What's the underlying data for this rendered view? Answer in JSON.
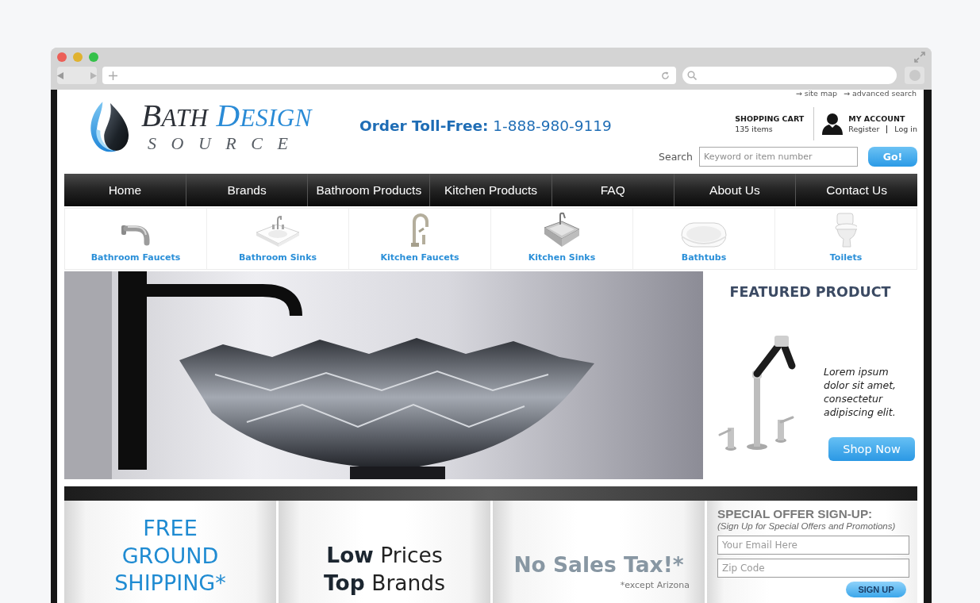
{
  "top_links": [
    "→ site map",
    "→ advanced search"
  ],
  "logo": {
    "name_dark": "BATH",
    "name_accent": "DESIGN",
    "tagline": "SOURCE"
  },
  "phone": "**Order Toll-Free:** 1-888-980-9119",
  "cart": {
    "title": "SHOPPING CART",
    "count": "135 items"
  },
  "account": {
    "title": "MY ACCOUNT",
    "links": [
      "Register",
      "Log in"
    ]
  },
  "search": {
    "label": "Search",
    "placeholder": "Keyword or item number",
    "button": "Go!"
  },
  "nav": [
    "Home",
    "Brands",
    "Bathroom Products",
    "Kitchen Products",
    "FAQ",
    "About Us",
    "Contact Us"
  ],
  "categories": [
    {
      "label": "Bathroom Faucets",
      "kind": "spout"
    },
    {
      "label": "Bathroom Sinks",
      "kind": "basin"
    },
    {
      "label": "Kitchen Faucets",
      "kind": "faucet"
    },
    {
      "label": "Kitchen Sinks",
      "kind": "steel-sink"
    },
    {
      "label": "Bathtubs",
      "kind": "tub"
    },
    {
      "label": "Toilets",
      "kind": "toilet"
    }
  ],
  "featured": {
    "title": "FEATURED PRODUCT",
    "description": "Lorem ipsum dolor sit amet, consectetur adipiscing elit.",
    "button": "Shop Now"
  },
  "promos": [
    {
      "kind": "shipping",
      "lines": [
        "FREE",
        "GROUND",
        "SHIPPING*"
      ]
    },
    {
      "kind": "prices",
      "lines": [
        "**Low** Prices",
        "**Top** Brands"
      ]
    },
    {
      "kind": "tax",
      "headline": "No Sales Tax!*",
      "note": "*except Arizona"
    },
    {
      "kind": "signup",
      "title": "SPECIAL OFFER SIGN-UP:",
      "subtitle": "(Sign Up for Special Offers and Promotions)",
      "fields": [
        {
          "placeholder": "Your Email Here"
        },
        {
          "placeholder": "Zip Code"
        }
      ],
      "button": "SIGN UP"
    }
  ]
}
